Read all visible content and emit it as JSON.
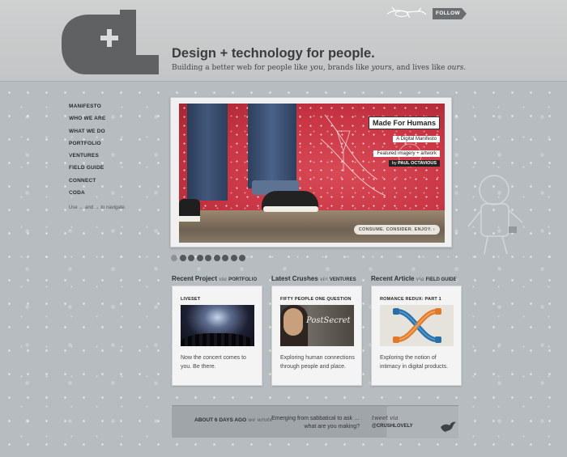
{
  "header": {
    "follow_label": "FOLLOW",
    "title": "Design + technology for people.",
    "subtitle_prefix": "Building a better web for people like ",
    "subtitle_em1": "you",
    "subtitle_mid": ", brands like ",
    "subtitle_em2": "yours",
    "subtitle_mid2": ", and lives like ",
    "subtitle_em3": "ours",
    "subtitle_end": "."
  },
  "nav": {
    "items": [
      {
        "label": "MANIFESTO"
      },
      {
        "label": "WHO WE ARE"
      },
      {
        "label": "WHAT WE DO"
      },
      {
        "label": "PORTFOLIO"
      },
      {
        "label": "VENTURES"
      },
      {
        "label": "FIELD GUIDE"
      },
      {
        "label": "CONNECT"
      },
      {
        "label": "CODA"
      }
    ],
    "hint": "Use ← and → to navigate."
  },
  "hero": {
    "title": "Made For Humans",
    "subtitle": "A Digital Manifesto",
    "featured": "Featured imagery + artwork",
    "by_prefix": "by ",
    "by_name": "PAUL OCTAVIOUS",
    "cta": "CONSUME. CONSIDER. ENJOY. ›"
  },
  "pager": {
    "count": 9,
    "active": 0
  },
  "cards": [
    {
      "heading": "Recent Project",
      "via": "via",
      "section": "PORTFOLIO",
      "label": "LIVESET",
      "thumb_icon": "concert-photo",
      "desc": "Now the concert comes to you. Be there."
    },
    {
      "heading": "Latest Crushes",
      "via": "via",
      "section": "VENTURES",
      "label": "FIFTY PEOPLE ONE QUESTION",
      "thumb_icon": "postsecret-photo",
      "thumb_text": "PostSecret",
      "desc": "Exploring human connections through people and place."
    },
    {
      "heading": "Recent Article",
      "via": "via",
      "section": "FIELD GUIDE",
      "label": "ROMANCE REDUX: PART 1",
      "thumb_icon": "dna-helix-illustration",
      "desc": "Exploring the notion of intimacy in digital products."
    }
  ],
  "tweet": {
    "time": "ABOUT 6 DAYS AGO",
    "we_wrote": "we wrote",
    "text": "Emerging from sabbatical to ask … what are you making?",
    "via": "tweet via",
    "handle": "@CRUSHLOVELY"
  },
  "colors": {
    "background": "#b6bcc0",
    "hero_red": "#c93645",
    "logo_gray": "#5f6163"
  }
}
